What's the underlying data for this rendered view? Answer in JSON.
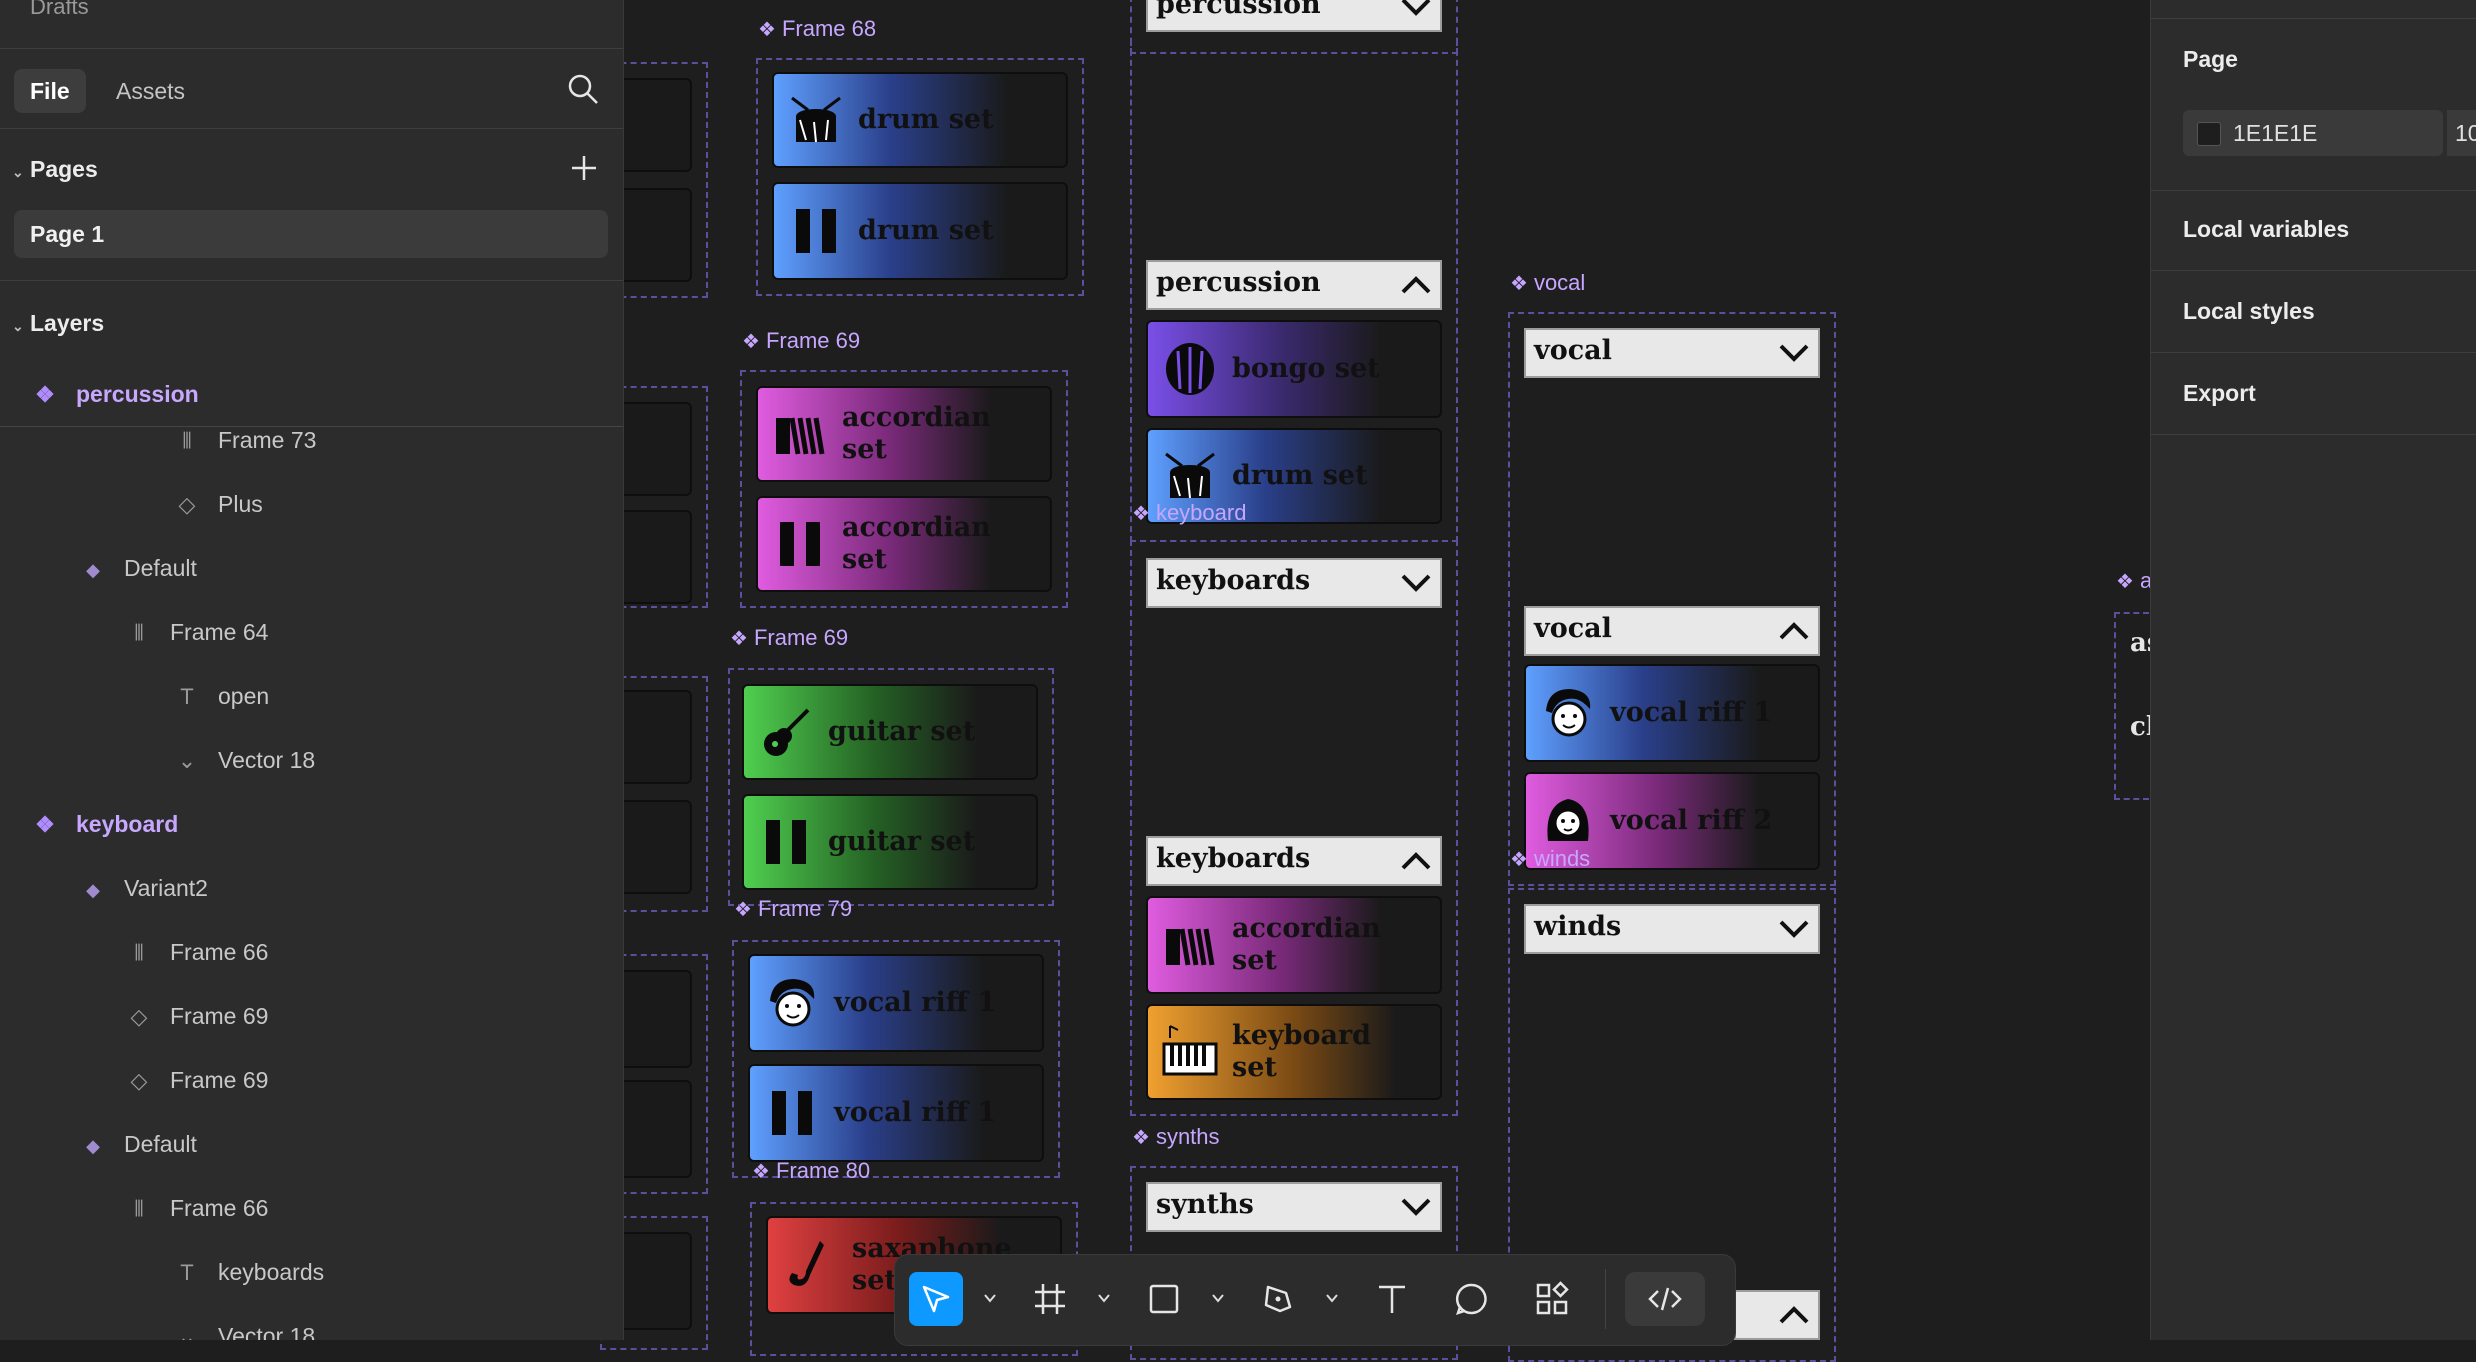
{
  "left_panel": {
    "drafts": "Drafts",
    "tabs": [
      "File",
      "Assets"
    ],
    "pages_header": "Pages",
    "page_item": "Page 1",
    "layers_header": "Layers",
    "layers": [
      {
        "label": "percussion",
        "icon": "component-icon"
      },
      {
        "label": "Frame 73",
        "icon": "auto-layout-icon"
      },
      {
        "label": "Plus",
        "icon": "variant-outline-icon"
      },
      {
        "label": "Default",
        "icon": "variant-icon"
      },
      {
        "label": "Frame 64",
        "icon": "auto-layout-icon"
      },
      {
        "label": "open",
        "icon": "text-icon"
      },
      {
        "label": "Vector 18",
        "icon": "vector-icon"
      },
      {
        "label": "keyboard",
        "icon": "component-icon"
      },
      {
        "label": "Variant2",
        "icon": "variant-icon"
      },
      {
        "label": "Frame 66",
        "icon": "auto-layout-icon"
      },
      {
        "label": "Frame 69",
        "icon": "variant-outline-icon"
      },
      {
        "label": "Frame 69",
        "icon": "variant-outline-icon"
      },
      {
        "label": "Default",
        "icon": "variant-icon"
      },
      {
        "label": "Frame 66",
        "icon": "auto-layout-icon"
      },
      {
        "label": "keyboards",
        "icon": "text-icon"
      },
      {
        "label": "Vector 18",
        "icon": "vector-icon"
      }
    ]
  },
  "canvas": {
    "frame_labels": [
      "Frame 68",
      "Frame 69",
      "Frame 69",
      "Frame 79",
      "Frame 80",
      "vocal",
      "keyboard",
      "winds",
      "synths",
      "a"
    ],
    "buttons": {
      "drum1": "drum set",
      "drum2": "drum set",
      "acc1": "accordian set",
      "acc2": "accordian set",
      "guitar1": "guitar set",
      "guitar2": "guitar set",
      "vocal1": "vocal riff 1",
      "vocal2": "vocal riff 1",
      "sax1": "saxaphone set",
      "bongo": "bongo set",
      "drum3": "drum set",
      "acc3": "accordian set",
      "kbd": "keyboard set",
      "vriff1": "vocal riff 1",
      "vriff2": "vocal riff 2"
    },
    "dropdowns": {
      "perc_top": "percussion",
      "perc_open": "percussion",
      "kbd_closed": "keyboards",
      "kbd_open": "keyboards",
      "synths": "synths",
      "vocal_closed": "vocal",
      "vocal_open": "vocal",
      "winds": "winds"
    },
    "partial_texts": [
      "as",
      "cl"
    ]
  },
  "right_panel": {
    "page_header": "Page",
    "bg_color": "1E1E1E",
    "opacity": "10",
    "local_variables": "Local variables",
    "local_styles": "Local styles",
    "export": "Export"
  },
  "colors": {
    "canvas_bg": "#1e1e1e",
    "panel_bg": "#2c2c2c",
    "accent": "#0d99ff",
    "component_purple": "#c6a6ff"
  }
}
